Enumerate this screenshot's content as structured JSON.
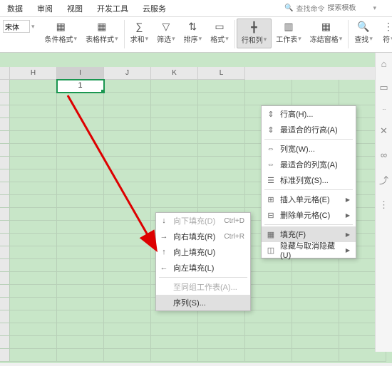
{
  "tabs": [
    "数据",
    "审阅",
    "视图",
    "开发工具",
    "云服务"
  ],
  "search": {
    "icon_label": "查找命令",
    "placeholder": "搜索模板"
  },
  "ribbon": {
    "font_size": "宋体",
    "groups": [
      {
        "name": "cond-format",
        "label": "条件格式",
        "glyph": "▦"
      },
      {
        "name": "table-style",
        "label": "表格样式",
        "glyph": "▦"
      },
      {
        "name": "sum",
        "label": "求和",
        "glyph": "∑"
      },
      {
        "name": "filter",
        "label": "筛选",
        "glyph": "▽"
      },
      {
        "name": "sort",
        "label": "排序",
        "glyph": "⇅"
      },
      {
        "name": "format",
        "label": "格式",
        "glyph": "▭"
      },
      {
        "name": "rowcol",
        "label": "行和列",
        "glyph": "╋",
        "active": true
      },
      {
        "name": "worksheet",
        "label": "工作表",
        "glyph": "▥"
      },
      {
        "name": "freeze",
        "label": "冻结窗格",
        "glyph": "▦"
      },
      {
        "name": "find",
        "label": "查找",
        "glyph": "🔍"
      },
      {
        "name": "symbol",
        "label": "符",
        "glyph": "⋮"
      }
    ]
  },
  "columns": [
    "H",
    "I",
    "J",
    "K",
    "L"
  ],
  "active_cell": {
    "col": "I",
    "value": "1"
  },
  "menu_rowcol": [
    {
      "icon": "⇕",
      "label": "行高(H)...",
      "type": "item"
    },
    {
      "icon": "⇕",
      "label": "最适合的行高(A)",
      "type": "item"
    },
    {
      "type": "sep"
    },
    {
      "icon": "⇔",
      "label": "列宽(W)...",
      "type": "item"
    },
    {
      "icon": "⇔",
      "label": "最适合的列宽(A)",
      "type": "item"
    },
    {
      "icon": "☰",
      "label": "标准列宽(S)...",
      "type": "item"
    },
    {
      "type": "sep"
    },
    {
      "icon": "⊞",
      "label": "插入单元格(E)",
      "type": "sub"
    },
    {
      "icon": "⊟",
      "label": "删除单元格(C)",
      "type": "sub"
    },
    {
      "type": "sep"
    },
    {
      "icon": "▦",
      "label": "填充(F)",
      "type": "sub",
      "hl": true
    },
    {
      "icon": "◫",
      "label": "隐藏与取消隐藏(U)",
      "type": "sub"
    }
  ],
  "menu_fill": [
    {
      "icon": "↓",
      "label": "向下填充(D)",
      "short": "Ctrl+D",
      "disabled": true
    },
    {
      "icon": "→",
      "label": "向右填充(R)",
      "short": "Ctrl+R"
    },
    {
      "icon": "↑",
      "label": "向上填充(U)"
    },
    {
      "icon": "←",
      "label": "向左填充(L)"
    },
    {
      "type": "sep"
    },
    {
      "icon": "",
      "label": "至同组工作表(A)...",
      "disabled": true
    },
    {
      "icon": "",
      "label": "序列(S)...",
      "hl": true
    }
  ],
  "side_icons": [
    "⌂",
    "▭",
    "···",
    "✕",
    "∞",
    "⤴",
    "⋮"
  ]
}
